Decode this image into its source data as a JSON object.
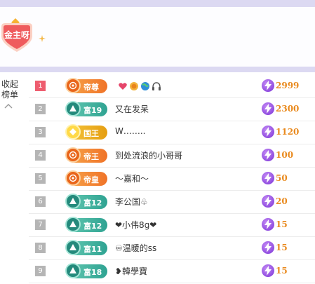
{
  "header": {
    "badge_text": "金主呀"
  },
  "collapse": {
    "line1": "收起",
    "line2": "榜单"
  },
  "rows": [
    {
      "rank": "1",
      "level": "帝尊",
      "level_style": "orange",
      "name": "",
      "score": "2999",
      "top": true
    },
    {
      "rank": "2",
      "level": "富19",
      "level_style": "teal",
      "name": "又在发呆",
      "score": "2300",
      "top": false
    },
    {
      "rank": "3",
      "level": "国王",
      "level_style": "gold",
      "name": "W……..",
      "score": "1120",
      "top": false
    },
    {
      "rank": "4",
      "level": "帝王",
      "level_style": "orange",
      "name": "到处流浪的小哥哥",
      "score": "100",
      "top": false
    },
    {
      "rank": "5",
      "level": "帝皇",
      "level_style": "orange",
      "name": "～嘉和～",
      "score": "50",
      "top": false
    },
    {
      "rank": "6",
      "level": "富12",
      "level_style": "teal",
      "name": "李公国♧",
      "score": "20",
      "top": false
    },
    {
      "rank": "7",
      "level": "富12",
      "level_style": "teal",
      "name": "❤小伟8g❤",
      "score": "15",
      "top": false
    },
    {
      "rank": "8",
      "level": "富11",
      "level_style": "teal",
      "name": "♾温暖的ss",
      "score": "15",
      "top": false
    },
    {
      "rank": "9",
      "level": "富18",
      "level_style": "teal",
      "name": "❥韓學寶",
      "score": "15",
      "top": false
    }
  ],
  "row1_extras": [
    "heart-icon",
    "medal-icon",
    "globe-icon",
    "headphones-icon"
  ],
  "colors": {
    "accent_strip": "#dcd9f2",
    "rank_top": "#ee5d6f",
    "rank_default": "#b5b5b5",
    "score": "#e98a1e",
    "coin": "#7a31d6"
  }
}
